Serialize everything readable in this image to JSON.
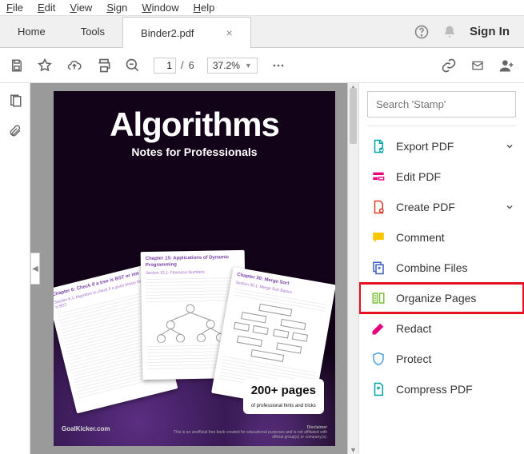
{
  "menu": {
    "file": "File",
    "edit": "Edit",
    "view": "View",
    "sign": "Sign",
    "window": "Window",
    "help": "Help"
  },
  "tabs": {
    "home": "Home",
    "tools": "Tools",
    "doc": "Binder2.pdf"
  },
  "header": {
    "signin": "Sign In"
  },
  "toolbar": {
    "page_current": "1",
    "page_sep": "/",
    "page_total": "6",
    "zoom": "37.2%"
  },
  "search": {
    "placeholder": "Search 'Stamp'"
  },
  "tools": [
    {
      "label": "Export PDF",
      "icon": "export-pdf",
      "chev": true,
      "color": "#00a3a3"
    },
    {
      "label": "Edit PDF",
      "icon": "edit-pdf",
      "color": "#e6007e"
    },
    {
      "label": "Create PDF",
      "icon": "create-pdf",
      "chev": true,
      "color": "#e03e2d"
    },
    {
      "label": "Comment",
      "icon": "comment",
      "color": "#f7c600"
    },
    {
      "label": "Combine Files",
      "icon": "combine",
      "color": "#3b5fc0"
    },
    {
      "label": "Organize Pages",
      "icon": "organize",
      "hl": true,
      "color": "#7bbf3a"
    },
    {
      "label": "Redact",
      "icon": "redact",
      "color": "#e6007e"
    },
    {
      "label": "Protect",
      "icon": "protect",
      "color": "#4da3e0"
    },
    {
      "label": "Compress PDF",
      "icon": "compress",
      "color": "#00a3a3"
    }
  ],
  "doc": {
    "title": "Algorithms",
    "subtitle": "Notes for Professionals",
    "cards": [
      {
        "h": "Chapter 6: Check if a tree is BST or not",
        "s": "Section 6.1: Algorithm to check if a given binary tree is BST"
      },
      {
        "h": "Chapter 15: Applications of Dynamic Programming",
        "s": "Section 15.1: Fibonacci Numbers"
      },
      {
        "h": "Chapter 30: Merge Sort",
        "s": "Section 30.1: Merge Sort Basics"
      }
    ],
    "badge_top": "200+ pages",
    "badge_sub": "of professional hints and tricks",
    "footer_site": "GoalKicker.com",
    "footer_disc_title": "Disclaimer",
    "footer_disc": "This is an unofficial free book created for educational purposes and is not affiliated with official group(s) or company(s)."
  }
}
